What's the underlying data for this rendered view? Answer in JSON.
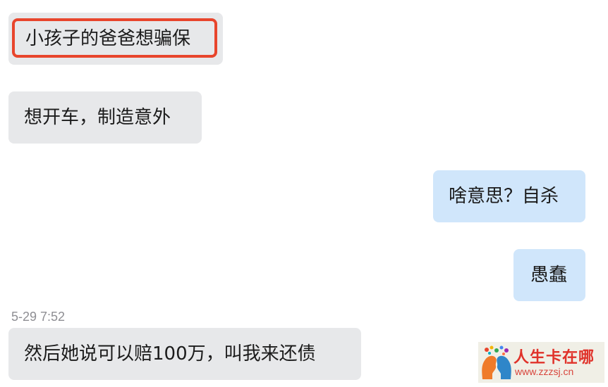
{
  "messages": [
    {
      "direction": "incoming",
      "text": "小孩子的爸爸想骗保",
      "highlighted": true
    },
    {
      "direction": "incoming",
      "text": "想开车，制造意外"
    },
    {
      "direction": "outgoing",
      "text": "啥意思？自杀"
    },
    {
      "direction": "outgoing",
      "text": "愚蠢"
    },
    {
      "direction": "incoming",
      "text": "然后她说可以赔100万，叫我来还债"
    }
  ],
  "timestamp": "5-29 7:52",
  "watermark": {
    "title": "人生卡在哪",
    "url": "www.zzzsj.cn",
    "icon": "two-heads-logo-icon"
  },
  "colors": {
    "incoming_bubble": "#e7e8ea",
    "outgoing_bubble": "#d0e6fb",
    "highlight_border": "#e8452c",
    "timestamp_text": "#8e8e93"
  }
}
